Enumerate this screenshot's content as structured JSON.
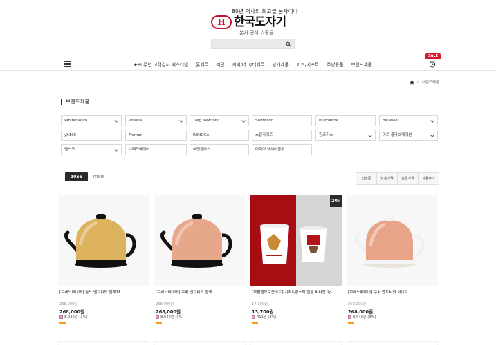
{
  "header": {
    "tagline": "80년 역사의 최고급 본차이나",
    "logo_mark": "H",
    "logo_text": "한국도자기",
    "subtag": "본사 공식 쇼핑몰",
    "search_placeholder": ""
  },
  "nav": {
    "links": [
      "★80주년 고객감사 페스티벌",
      "홈세트",
      "예단",
      "커피/머그/티세트",
      "낱개제품",
      "키즈/기프트",
      "주방용품",
      "브랜드제품"
    ],
    "sale_label": "SALE"
  },
  "breadcrumb": {
    "current": "브랜드제품"
  },
  "section": {
    "title": "브랜드제품"
  },
  "filters": [
    {
      "label": "Whitebloom",
      "dropdown": true
    },
    {
      "label": "Prouna",
      "dropdown": true
    },
    {
      "label": "Twig NewYork",
      "dropdown": true
    },
    {
      "label": "Seltmann",
      "dropdown": false
    },
    {
      "label": "Blumarine",
      "dropdown": false
    },
    {
      "label": "Bellevie",
      "dropdown": true
    },
    {
      "label": "yh105",
      "dropdown": false
    },
    {
      "label": "Flamor",
      "dropdown": false
    },
    {
      "label": "REHOCA",
      "dropdown": false
    },
    {
      "label": "스칼라이트",
      "dropdown": false
    },
    {
      "label": "킹코히스",
      "dropdown": true
    },
    {
      "label": "아트 콜라보레이션",
      "dropdown": true
    },
    {
      "label": "덴스크",
      "dropdown": true
    },
    {
      "label": "브레드메이어",
      "dropdown": false
    },
    {
      "label": "예민글라스",
      "dropdown": false
    },
    {
      "label": "마리아 엑셔이블루",
      "dropdown": false
    }
  ],
  "listing": {
    "count": "1056",
    "count_label": "ITEMS",
    "sort_options": [
      "신상품",
      "낮은가격",
      "높은가격",
      "사용후기"
    ]
  },
  "products": [
    {
      "name": "[브레드메이어] 골드 맨트티팟 블랙1ℓ",
      "orig_price": "268,000원",
      "price": "268,000원",
      "point": "8,040원 (3%)",
      "discount": "",
      "image": "gold-teapot"
    },
    {
      "name": "[브레드메이어] 쿠퍼 맨트티팟 블랙",
      "orig_price": "268,000원",
      "price": "268,000원",
      "point": "8,040원 (3%)",
      "discount": "",
      "image": "copper-teapot-black"
    },
    {
      "name": "[부활엔브로큰하트] 지치&림스틱 킬른 퍼티컵 2p",
      "orig_price": "17,100원",
      "price": "13,700원",
      "point": "411원 (3%)",
      "discount": "20",
      "discount_unit": "%",
      "image": "kids-cups"
    },
    {
      "name": "[브레드메이어] 쿠퍼 맨트티팟 화이트",
      "orig_price": "268,000원",
      "price": "268,000원",
      "point": "8,040원 (3%)",
      "discount": "",
      "image": "copper-teapot-white"
    }
  ],
  "colors": {
    "brand_red": "#c8102e",
    "gold": "#e3b45c",
    "copper": "#e9a58a",
    "promo_red": "#b3131b"
  }
}
